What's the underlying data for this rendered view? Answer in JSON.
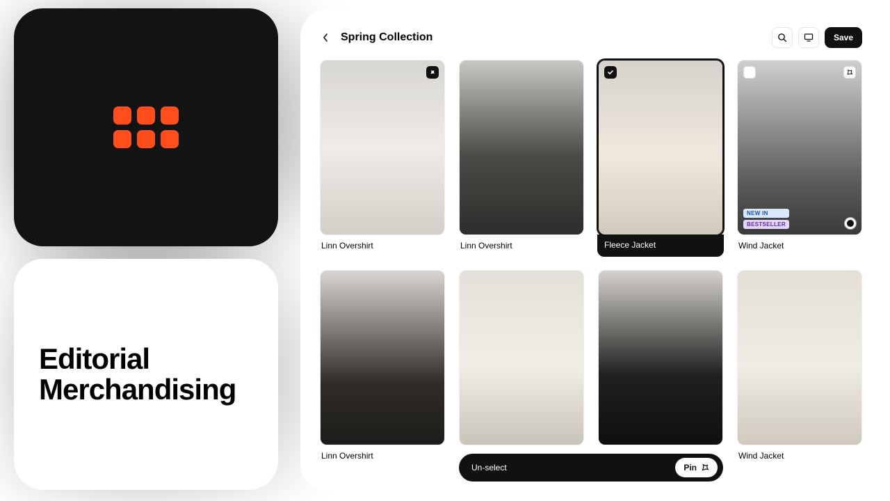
{
  "logo": {
    "accent": "#ff4d1c"
  },
  "promo": {
    "title_line1": "Editorial",
    "title_line2": "Merchandising"
  },
  "header": {
    "title": "Spring Collection",
    "save_label": "Save"
  },
  "action_bar": {
    "unselect_label": "Un-select",
    "pin_label": "Pin"
  },
  "badges": {
    "new_in": "NEW IN",
    "bestseller": "BESTSELLER"
  },
  "products": [
    {
      "name": "Linn Overshirt",
      "pinned": true,
      "selected": false,
      "tone": "m1",
      "badges": []
    },
    {
      "name": "Linn Overshirt",
      "pinned": false,
      "selected": false,
      "tone": "m2",
      "badges": []
    },
    {
      "name": "Fleece Jacket",
      "pinned": false,
      "selected": true,
      "tone": "m3",
      "badges": []
    },
    {
      "name": "Wind Jacket",
      "pinned": false,
      "selected": false,
      "tone": "m4",
      "badges": [
        "new_in",
        "bestseller"
      ],
      "pin_outline": true,
      "unchecked": true,
      "color_dot": true
    },
    {
      "name": "Linn Overshirt",
      "pinned": false,
      "selected": false,
      "tone": "m5",
      "badges": []
    },
    {
      "name": "",
      "pinned": false,
      "selected": false,
      "tone": "m6",
      "badges": []
    },
    {
      "name": "",
      "pinned": false,
      "selected": false,
      "tone": "m7",
      "badges": []
    },
    {
      "name": "Wind Jacket",
      "pinned": false,
      "selected": false,
      "tone": "m8",
      "badges": []
    }
  ]
}
